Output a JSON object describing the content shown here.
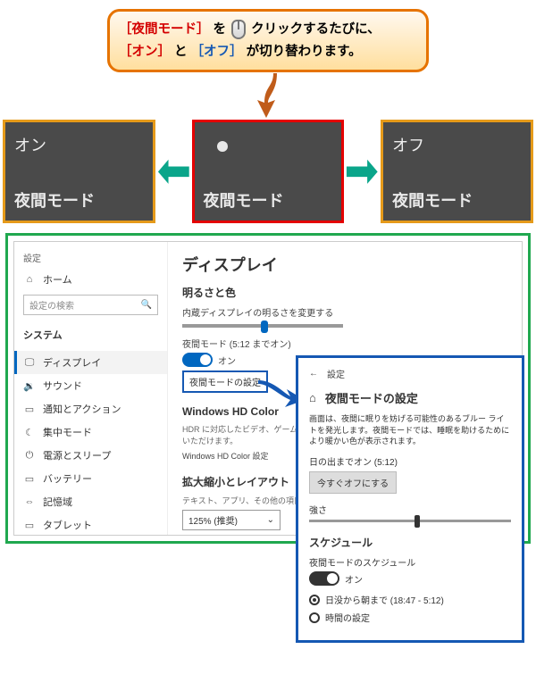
{
  "callout": {
    "part1_red": "［夜間モード］",
    "part1_plain_a": "を",
    "part1_plain_b": "クリックするたびに、",
    "part2_red_a": "［オン］",
    "part2_plain_a": "と",
    "part2_blue": "［オフ］",
    "part2_plain_b": "が切り替わります。"
  },
  "tiles": {
    "on_state": "オン",
    "off_state": "オフ",
    "label": "夜間モード"
  },
  "settings": {
    "window_title": "設定",
    "home": "ホーム",
    "search_placeholder": "設定の検索",
    "section": "システム",
    "menu": {
      "display": "ディスプレイ",
      "sound": "サウンド",
      "notifications": "通知とアクション",
      "focus": "集中モード",
      "power": "電源とスリープ",
      "battery": "バッテリー",
      "storage": "記憶域",
      "tablet": "タブレット"
    },
    "main": {
      "title": "ディスプレイ",
      "brightness_heading": "明るさと色",
      "brightness_desc": "内蔵ディスプレイの明るさを変更する",
      "night_light_label": "夜間モード (5:12 までオン)",
      "toggle_on": "オン",
      "night_light_settings_link": "夜間モードの設定",
      "hd_heading": "Windows HD Color",
      "hd_desc1": "HDR に対応したビデオ、ゲーム、…",
      "hd_desc2": "いただけます。",
      "hd_link": "Windows HD Color 設定",
      "scale_heading": "拡大縮小とレイアウト",
      "scale_desc": "テキスト、アプリ、その他の項目の…",
      "scale_value": "125% (推奨)"
    }
  },
  "subwindow": {
    "breadcrumb": "設定",
    "title": "夜間モードの設定",
    "description": "画面は、夜間に眠りを妨げる可能性のあるブルー ライトを発光します。夜間モードでは、睡眠を助けるためにより暖かい色が表示されます。",
    "until_label": "日の出までオン (5:12)",
    "off_now_btn": "今すぐオフにする",
    "strength_label": "強さ",
    "schedule_heading": "スケジュール",
    "schedule_toggle_label": "夜間モードのスケジュール",
    "schedule_toggle_state": "オン",
    "radio_sunset": "日没から朝まで (18:47 - 5:12)",
    "radio_custom": "時間の設定"
  }
}
